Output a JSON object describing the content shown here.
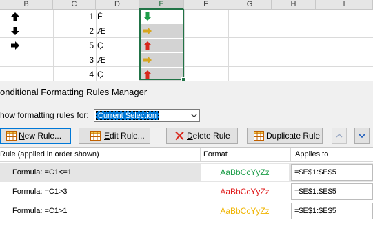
{
  "sheet": {
    "columns": [
      "B",
      "C",
      "D",
      "E",
      "F",
      "G",
      "H",
      "I"
    ],
    "selected_column": "E",
    "rows": [
      {
        "b_icon": "arrow-up-icon",
        "c": "1",
        "d": "È",
        "e_icon": "arrow-down-icon",
        "e_color": "#1e9e4a"
      },
      {
        "b_icon": "arrow-down-icon",
        "c": "2",
        "d": "Æ",
        "e_icon": "arrow-right-icon",
        "e_color": "#d6a520"
      },
      {
        "b_icon": "arrow-right-icon",
        "c": "5",
        "d": "Ç",
        "e_icon": "arrow-up-icon",
        "e_color": "#d8281c"
      },
      {
        "b_icon": "",
        "c": "3",
        "d": "Æ",
        "e_icon": "arrow-right-icon",
        "e_color": "#d6a520"
      },
      {
        "b_icon": "",
        "c": "4",
        "d": "Ç",
        "e_icon": "arrow-up-icon",
        "e_color": "#d8281c"
      }
    ]
  },
  "dialog": {
    "title": "onditional Formatting Rules Manager",
    "show_rules_label": "how formatting rules for:",
    "show_rules_value": "Current Selection",
    "buttons": {
      "new_rule": "New Rule...",
      "edit_rule": "Edit Rule...",
      "delete_rule": "Delete Rule",
      "duplicate_rule": "Duplicate Rule"
    },
    "headers": {
      "rule": "Rule (applied in order shown)",
      "format": "Format",
      "applies_to": "Applies to"
    },
    "rules": [
      {
        "rule": "Formula: =C1<=1",
        "preview": "AaBbCcYyZz",
        "color": "#1e9e4a",
        "applies_to": "=$E$1:$E$5"
      },
      {
        "rule": "Formula: =C1>3",
        "preview": "AaBbCcYyZz",
        "color": "#e01b1b",
        "applies_to": "=$E$1:$E$5"
      },
      {
        "rule": "Formula: =C1>1",
        "preview": "AaBbCcYyZz",
        "color": "#f0b400",
        "applies_to": "=$E$1:$E$5"
      }
    ]
  }
}
